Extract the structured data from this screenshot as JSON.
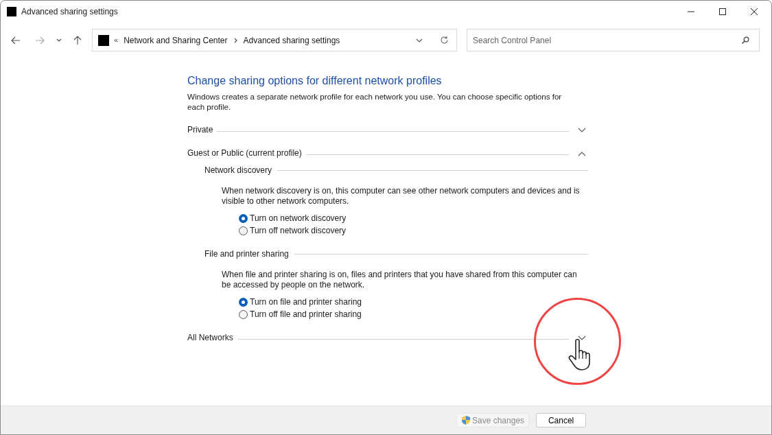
{
  "window": {
    "title": "Advanced sharing settings"
  },
  "address": {
    "prefix": "«",
    "path": [
      "Network and Sharing Center",
      "Advanced sharing settings"
    ]
  },
  "search": {
    "placeholder": "Search Control Panel"
  },
  "heading": "Change sharing options for different network profiles",
  "intro": "Windows creates a separate network profile for each network you use. You can choose specific options for each profile.",
  "profiles": [
    {
      "name": "Private",
      "expanded": false
    },
    {
      "name": "Guest or Public (current profile)",
      "expanded": true,
      "sections": [
        {
          "title": "Network discovery",
          "description": "When network discovery is on, this computer can see other network computers and devices and is visible to other network computers.",
          "options": [
            {
              "label": "Turn on network discovery",
              "selected": true
            },
            {
              "label": "Turn off network discovery",
              "selected": false
            }
          ]
        },
        {
          "title": "File and printer sharing",
          "description": "When file and printer sharing is on, files and printers that you have shared from this computer can be accessed by people on the network.",
          "options": [
            {
              "label": "Turn on file and printer sharing",
              "selected": true
            },
            {
              "label": "Turn off file and printer sharing",
              "selected": false
            }
          ]
        }
      ]
    },
    {
      "name": "All Networks",
      "expanded": false
    }
  ],
  "buttons": [
    {
      "label": "Save changes",
      "kind": "shield",
      "disabled": true
    },
    {
      "label": "Cancel",
      "kind": "plain",
      "disabled": false
    }
  ]
}
